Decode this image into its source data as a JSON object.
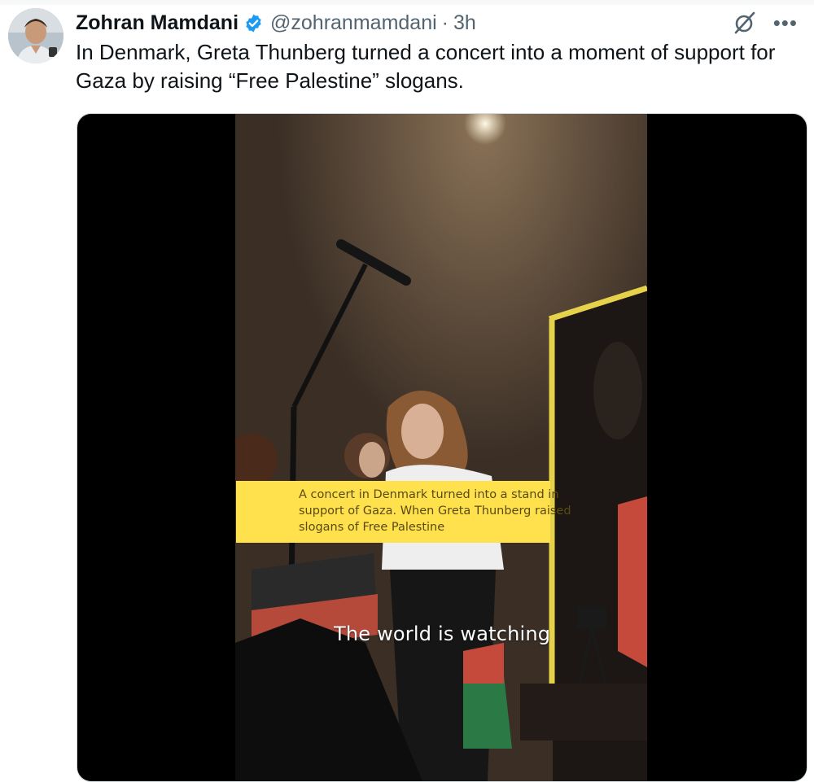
{
  "author": {
    "name": "Zohran Mamdani",
    "handle": "@zohranmamdani",
    "separator": "·",
    "time": "3h",
    "verified": true
  },
  "tweet": {
    "text": "In Denmark, Greta Thunberg turned a concert into a moment of support for Gaza by raising “Free Palestine” slogans."
  },
  "media": {
    "caption": "A concert in Denmark turned into a stand in support of Gaza. When Greta Thunberg raised slogans of Free Palestine",
    "subtitle": "The world is watching"
  },
  "icons": {
    "verified": "verified-badge-icon",
    "grok": "grok-icon",
    "more": "more-icon"
  },
  "colors": {
    "verified_blue": "#1d9bf0",
    "caption_yellow": "#ffe14d",
    "muted_text": "#536471"
  }
}
